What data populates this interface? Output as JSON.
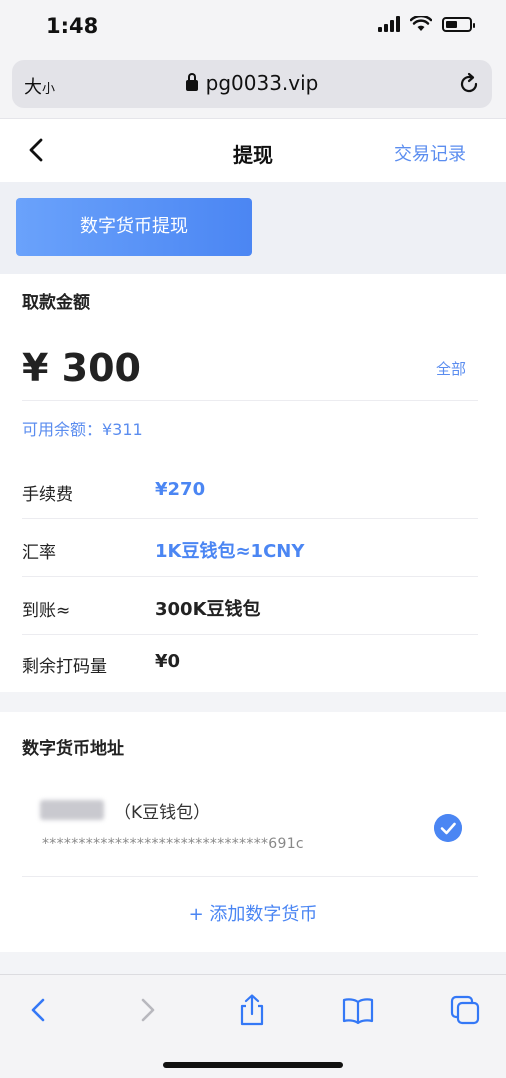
{
  "status": {
    "time": "1:48",
    "battery_level": 0.5
  },
  "browser": {
    "size_label_big": "大",
    "size_label_small": "小",
    "url": "pg0033.vip"
  },
  "nav": {
    "title": "提现",
    "record_label": "交易记录"
  },
  "tab": {
    "label": "数字货币提现"
  },
  "withdraw": {
    "section_label": "取款金额",
    "amount": "¥ 300",
    "all_label": "全部",
    "available": "可用余额：¥311",
    "rows": [
      {
        "label": "手续费",
        "value": "¥270"
      },
      {
        "label": "汇率",
        "value": "1K豆钱包≈1CNY"
      },
      {
        "label": "到账≈",
        "value": "300K豆钱包"
      },
      {
        "label": "剩余打码量",
        "value": "¥0"
      }
    ]
  },
  "address": {
    "section_label": "数字货币地址",
    "coin_name": "（K豆钱包）",
    "address": "*******************************691c",
    "add_label": "+ 添加数字货币"
  },
  "colors": {
    "accent": "#4b86f3",
    "link": "#5b8def"
  }
}
